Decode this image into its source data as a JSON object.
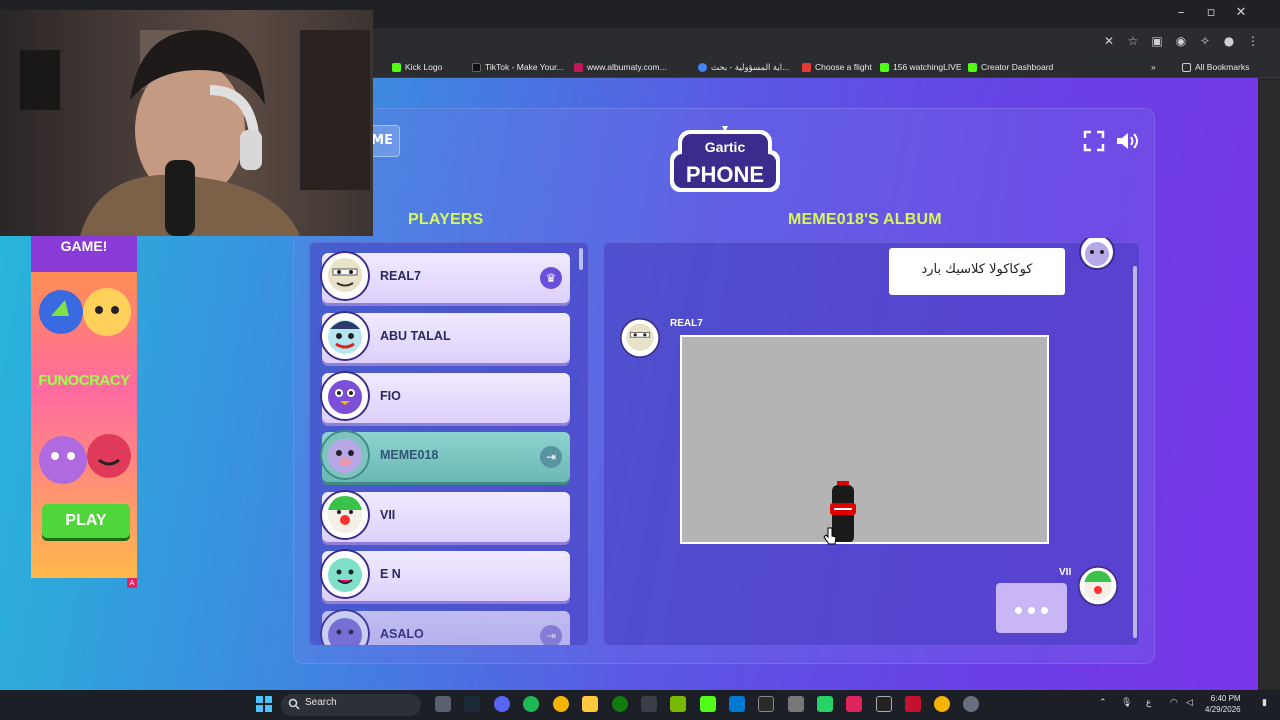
{
  "browser": {
    "bookmarks": [
      {
        "label": "Kick Logo",
        "color": "#53fc18"
      },
      {
        "label": "TikTok - Make Your...",
        "color": "#111111"
      },
      {
        "label": "www.albumaty.com...",
        "color": "#c2185b"
      },
      {
        "label": "اية المسؤولية - بحث...",
        "color": "#4285f4"
      },
      {
        "label": "Choose a flight",
        "color": "#e53935"
      },
      {
        "label": "156 watchingLIVE",
        "color": "#53fc18"
      },
      {
        "label": "Creator Dashboard",
        "color": "#53fc18"
      }
    ],
    "all_bookmarks_label": "All Bookmarks",
    "overflow_label": "»"
  },
  "game": {
    "back_button_label": "ME",
    "players_title": "PLAYERS",
    "album_title": "MEME018'S ALBUM",
    "players": [
      {
        "name": "REAL7",
        "badge": "crown-icon",
        "badge_glyph": "♛",
        "color": "#e8e2c8"
      },
      {
        "name": "ABU TALAL",
        "badge": "",
        "badge_glyph": "",
        "color": "#b8e6f0"
      },
      {
        "name": "FIO",
        "badge": "",
        "badge_glyph": "",
        "color": "#7b4fd6"
      },
      {
        "name": "MEME018",
        "badge": "exit-icon",
        "badge_glyph": "⇥",
        "color": "#b8a8e8"
      },
      {
        "name": "VII",
        "badge": "",
        "badge_glyph": "",
        "color": "#ff5a5a"
      },
      {
        "name": "E N",
        "badge": "",
        "badge_glyph": "",
        "color": "#7fe0c8"
      },
      {
        "name": "ASALO",
        "badge": "exit-icon",
        "badge_glyph": "⇥",
        "color": "#8a7ad8"
      }
    ],
    "album": {
      "first_text": "كوكاكولا كلاسيك بارد",
      "drawing_author": "REAL7",
      "next_author": "VII"
    },
    "accent_color": "#d7f85b"
  },
  "ad": {
    "top_text": "GAME!",
    "brand_text": "FUNOCRACY",
    "play_label": "PLAY",
    "ad_marker": "A"
  },
  "taskbar": {
    "search_label": "Search",
    "time": "6:40 PM",
    "date": "4/29/2026",
    "lang": "ع"
  }
}
